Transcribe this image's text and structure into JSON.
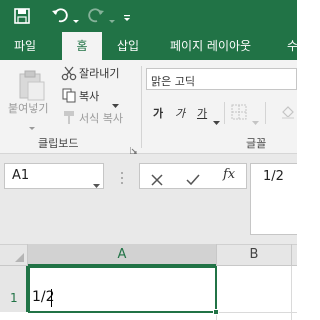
{
  "ribbon_tabs": [
    {
      "label": "파일",
      "active": false
    },
    {
      "label": "홈",
      "active": true
    },
    {
      "label": "삽입",
      "active": false
    },
    {
      "label": "페이지 레이아웃",
      "active": false
    },
    {
      "label": "수",
      "active": false
    }
  ],
  "clipboard": {
    "paste_label": "붙여넣기",
    "cut_label": "잘라내기",
    "copy_label": "복사",
    "format_painter_label": "서식 복사",
    "group_label": "클립보드"
  },
  "font": {
    "font_name": "맑은 고딕",
    "bold_glyph": "가",
    "italic_glyph": "가",
    "underline_glyph": "가",
    "group_label": "글꼴"
  },
  "formula_bar": {
    "name_box": "A1",
    "fx_label": "fx",
    "formula": "1/2"
  },
  "grid": {
    "columns": [
      "A",
      "B"
    ],
    "rows": [
      "1"
    ],
    "cells": {
      "A1": "1/2"
    }
  },
  "colors": {
    "accent": "#217346",
    "selection": "#217346"
  }
}
